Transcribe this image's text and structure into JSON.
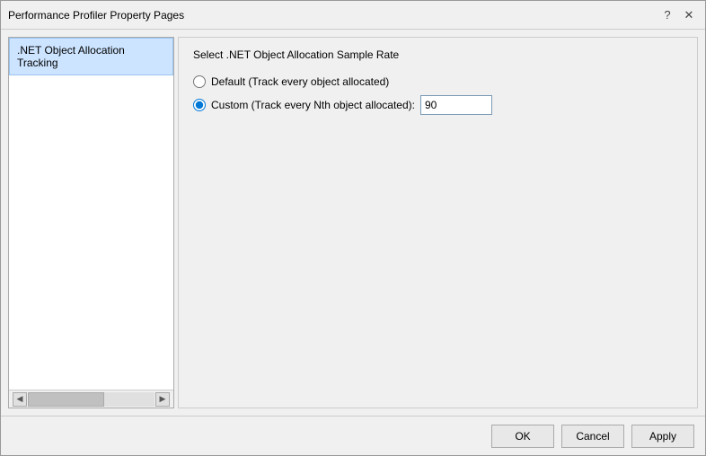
{
  "window": {
    "title": "Performance Profiler Property Pages",
    "help_button": "?",
    "close_button": "✕"
  },
  "left_panel": {
    "items": [
      {
        "label": ".NET Object Allocation Tracking",
        "selected": true
      }
    ]
  },
  "right_panel": {
    "section_title": "Select .NET Object Allocation Sample Rate",
    "options": [
      {
        "id": "default",
        "label": "Default (Track every object allocated)",
        "checked": false
      },
      {
        "id": "custom",
        "label": "Custom (Track every Nth object allocated):",
        "checked": true,
        "value": "90"
      }
    ]
  },
  "footer": {
    "ok_label": "OK",
    "cancel_label": "Cancel",
    "apply_label": "Apply"
  }
}
